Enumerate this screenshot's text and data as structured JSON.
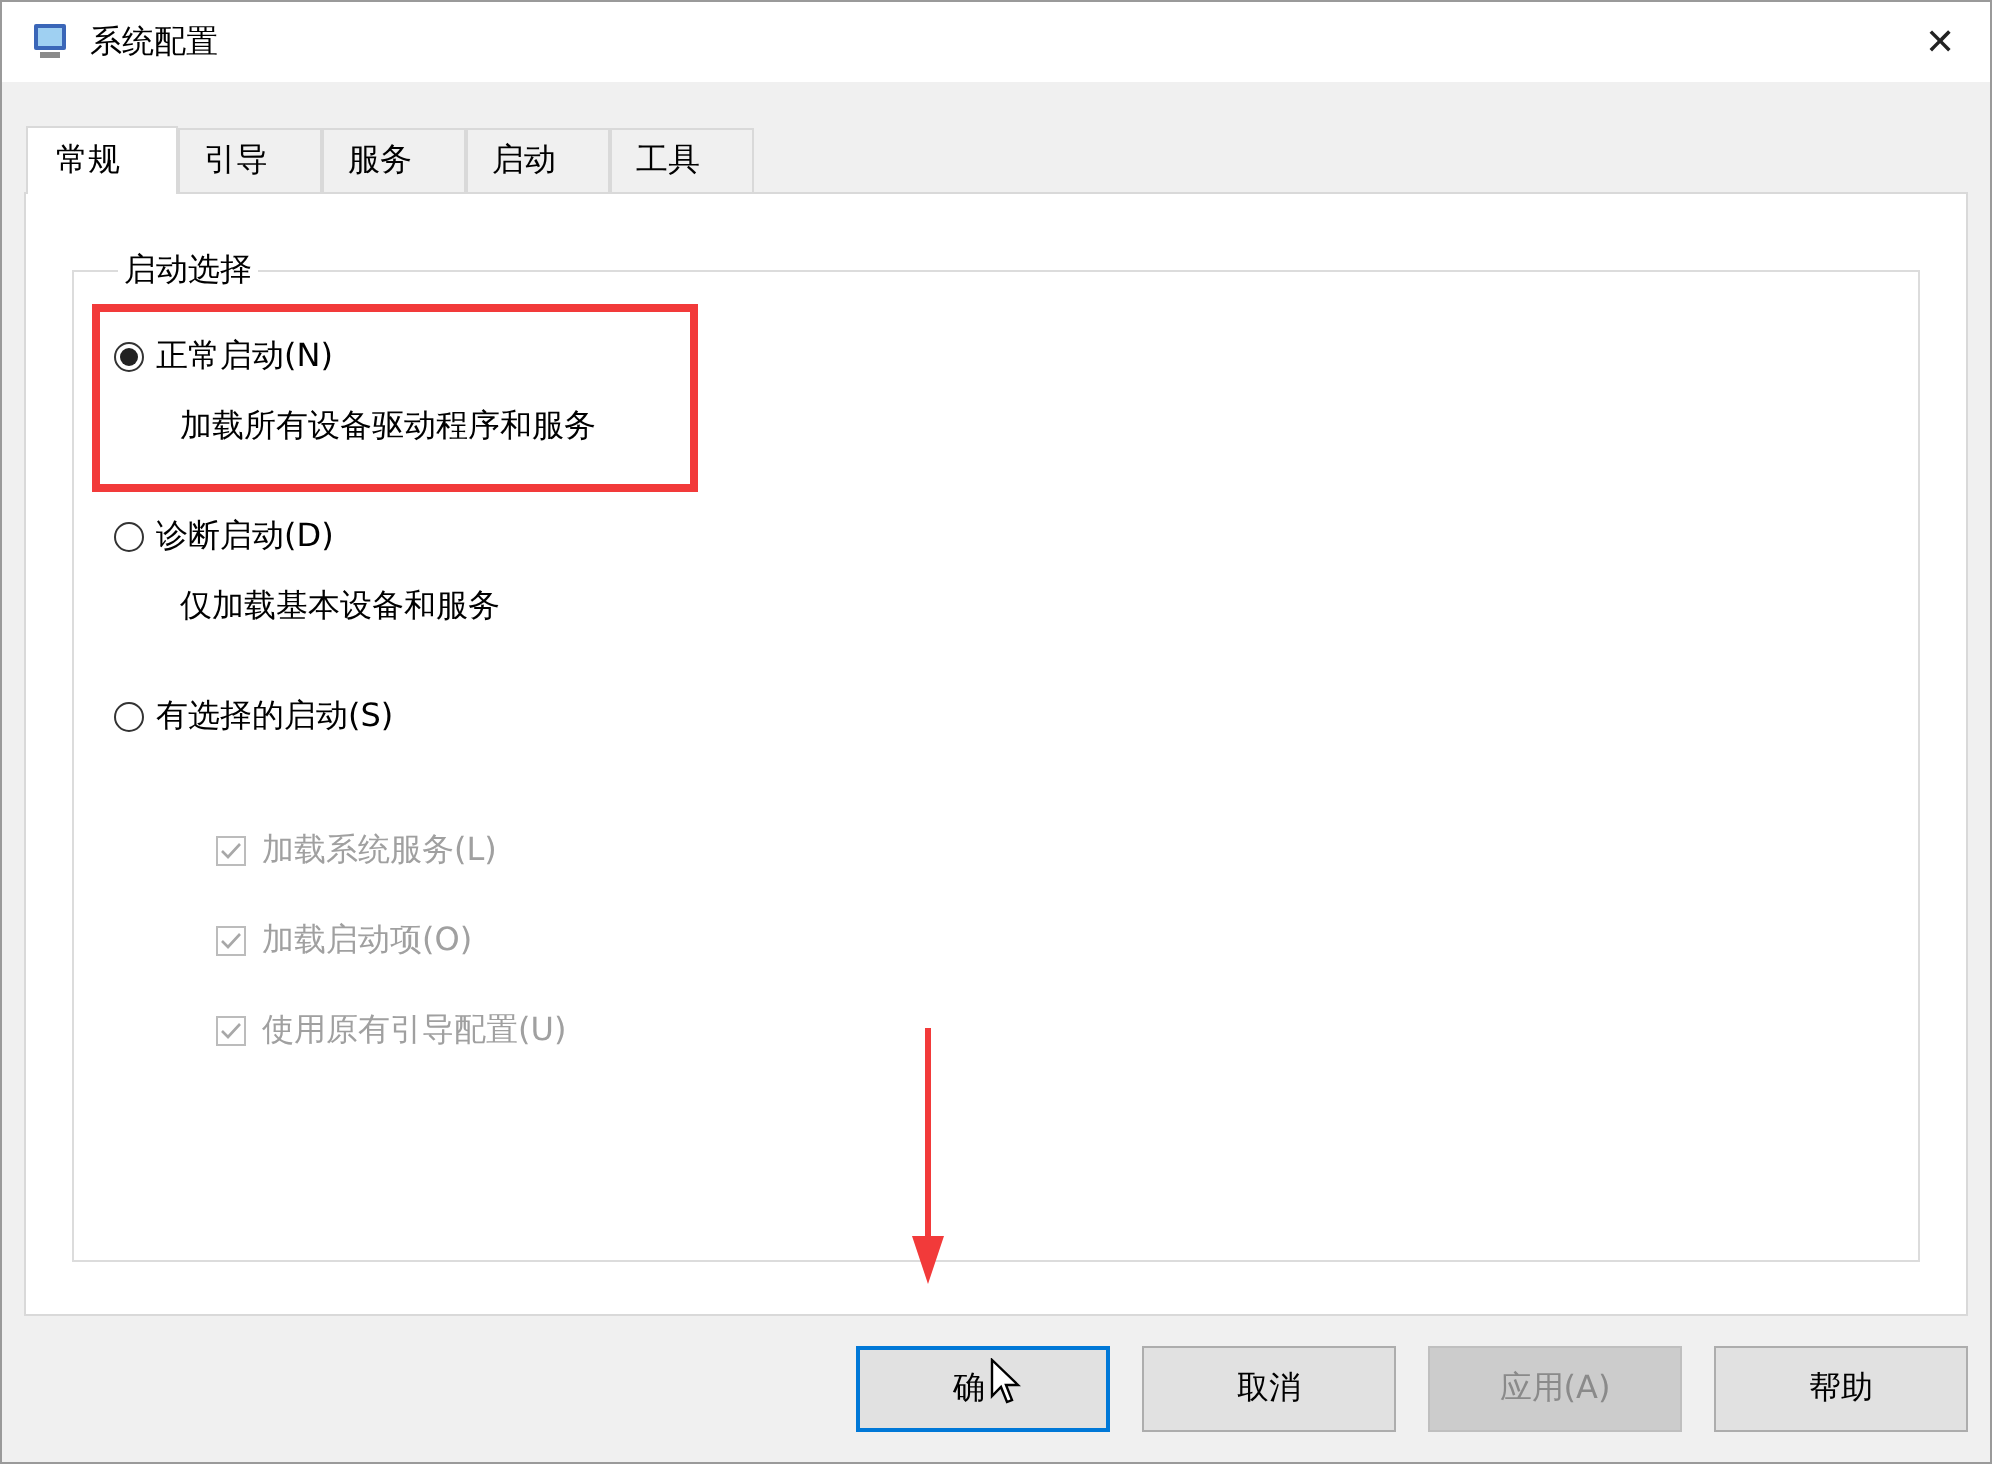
{
  "window": {
    "title": "系统配置",
    "close": "✕"
  },
  "tabs": [
    {
      "label": "常规",
      "selected": true
    },
    {
      "label": "引导",
      "selected": false
    },
    {
      "label": "服务",
      "selected": false
    },
    {
      "label": "启动",
      "selected": false
    },
    {
      "label": "工具",
      "selected": false
    }
  ],
  "group": {
    "title": "启动选择",
    "options": [
      {
        "label": "正常启动(N)",
        "description": "加载所有设备驱动程序和服务",
        "selected": true
      },
      {
        "label": "诊断启动(D)",
        "description": "仅加载基本设备和服务",
        "selected": false
      },
      {
        "label": "有选择的启动(S)",
        "selected": false
      }
    ],
    "checks": [
      {
        "label": "加载系统服务(L)",
        "checked": true,
        "disabled": true
      },
      {
        "label": "加载启动项(O)",
        "checked": true,
        "disabled": true
      },
      {
        "label": "使用原有引导配置(U)",
        "checked": true,
        "disabled": true
      }
    ]
  },
  "buttons": [
    {
      "label": "确",
      "kind": "default"
    },
    {
      "label": "取消",
      "kind": "normal"
    },
    {
      "label": "应用(A)",
      "kind": "disabled"
    },
    {
      "label": "帮助",
      "kind": "normal"
    }
  ]
}
